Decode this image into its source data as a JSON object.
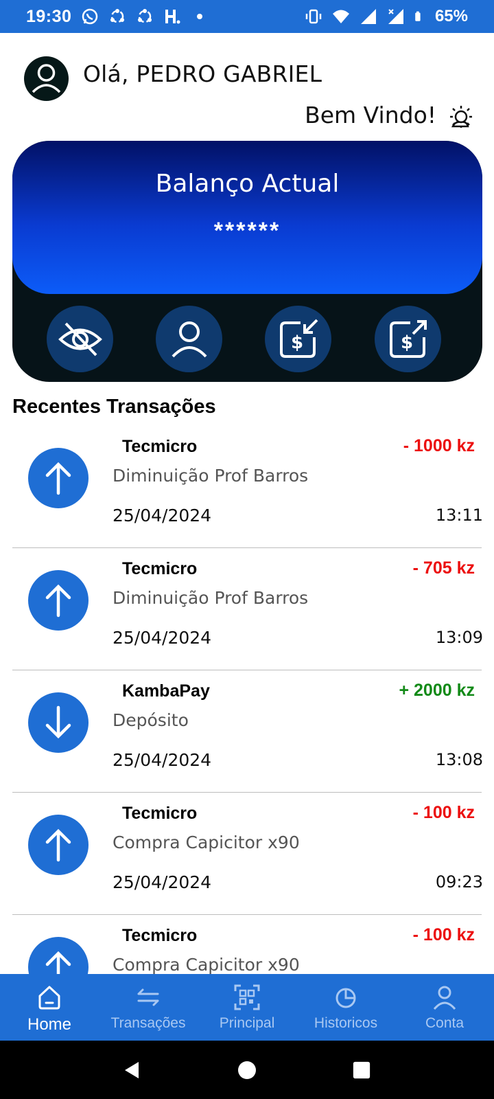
{
  "status_bar": {
    "time": "19:30",
    "battery": "65%",
    "icons": [
      "whatsapp-icon",
      "sync-icon",
      "sync-icon",
      "h-icon",
      "dot-icon",
      "vibrate-icon",
      "wifi-icon",
      "signal-icon",
      "signal-icon",
      "battery-icon"
    ]
  },
  "header": {
    "greeting": "Olá, PEDRO GABRIEL",
    "welcome": "Bem Vindo!",
    "avatar_icon": "user-icon",
    "weather_icon": "sun-cloud-icon"
  },
  "balance_card": {
    "title": "Balanço Actual",
    "value": "******",
    "actions": [
      "hide-balance",
      "profile",
      "receive-money",
      "send-money"
    ],
    "colors": {
      "gradient_top": "#021166",
      "gradient_bottom": "#0c5cf8",
      "card_base": "#061318",
      "action_bg": "#0f3a6e"
    }
  },
  "transactions": {
    "title": "Recentes Transações",
    "items": [
      {
        "name": "Tecmicro",
        "amount": "- 1000 kz",
        "description": "Diminuição Prof Barros",
        "date": "25/04/2024",
        "time": "13:11",
        "direction": "out"
      },
      {
        "name": "Tecmicro",
        "amount": "- 705 kz",
        "description": "Diminuição Prof Barros",
        "date": "25/04/2024",
        "time": "13:09",
        "direction": "out"
      },
      {
        "name": "KambaPay",
        "amount": "+ 2000 kz",
        "description": "Depósito",
        "date": "25/04/2024",
        "time": "13:08",
        "direction": "in"
      },
      {
        "name": "Tecmicro",
        "amount": "- 100 kz",
        "description": "Compra Capicitor x90",
        "date": "25/04/2024",
        "time": "09:23",
        "direction": "out"
      },
      {
        "name": "Tecmicro",
        "amount": "- 100 kz",
        "description": "Compra Capicitor x90",
        "date": "",
        "time": "",
        "direction": "out"
      }
    ]
  },
  "bottom_nav": {
    "items": [
      {
        "label": "Home",
        "icon": "home-icon",
        "active": true
      },
      {
        "label": "Transações",
        "icon": "transfer-icon",
        "active": false
      },
      {
        "label": "Principal",
        "icon": "qr-scan-icon",
        "active": false
      },
      {
        "label": "Historicos",
        "icon": "pie-chart-icon",
        "active": false
      },
      {
        "label": "Conta",
        "icon": "account-icon",
        "active": false
      }
    ]
  },
  "colors": {
    "primary": "#1f6ed4",
    "negative": "#ec0f0f",
    "positive": "#138a18"
  }
}
